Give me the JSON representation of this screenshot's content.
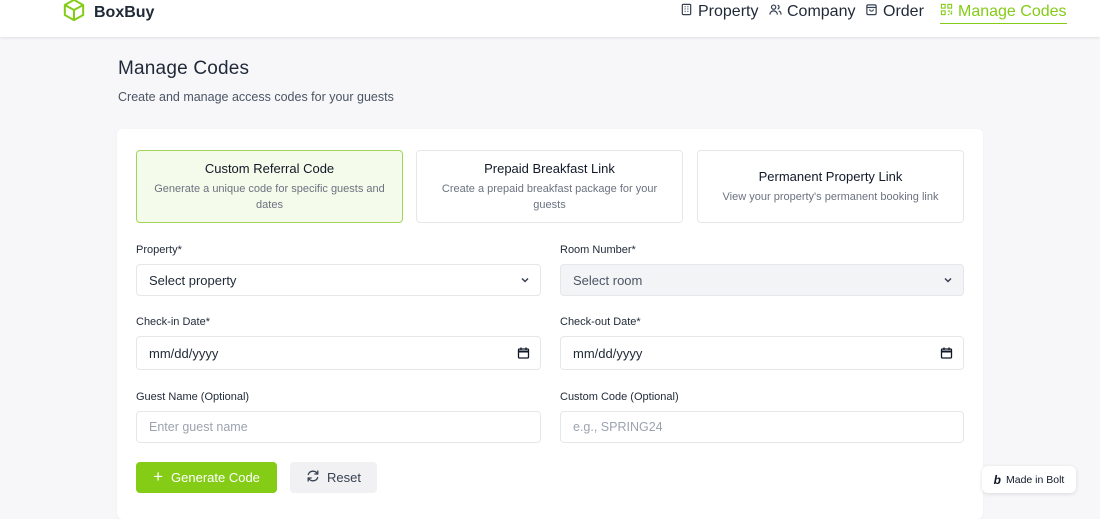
{
  "app": {
    "name": "BoxBuy",
    "brand_color": "#84cc16"
  },
  "nav": {
    "items": [
      {
        "label": "Property",
        "icon": "building-icon"
      },
      {
        "label": "Company",
        "icon": "users-icon"
      },
      {
        "label": "Order",
        "icon": "shopping-bag-icon"
      },
      {
        "label": "Manage Codes",
        "icon": "qr-code-icon",
        "active": true
      }
    ]
  },
  "page": {
    "title": "Manage Codes",
    "subtitle": "Create and manage access codes for your guests"
  },
  "code_types": [
    {
      "title": "Custom Referral Code",
      "description": "Generate a unique code for specific guests and dates",
      "selected": true
    },
    {
      "title": "Prepaid Breakfast Link",
      "description": "Create a prepaid breakfast package for your guests",
      "selected": false
    },
    {
      "title": "Permanent Property Link",
      "description": "View your property's permanent booking link",
      "selected": false
    }
  ],
  "form": {
    "property": {
      "label": "Property*",
      "value": "Select property"
    },
    "room": {
      "label": "Room Number*",
      "value": "Select room"
    },
    "checkin": {
      "label": "Check-in Date*",
      "value": "mm/dd/yyyy"
    },
    "checkout": {
      "label": "Check-out Date*",
      "value": "mm/dd/yyyy"
    },
    "guest_name": {
      "label": "Guest Name (Optional)",
      "placeholder": "Enter guest name"
    },
    "custom_code": {
      "label": "Custom Code (Optional)",
      "placeholder": "e.g., SPRING24"
    }
  },
  "actions": {
    "generate": "Generate Code",
    "reset": "Reset"
  },
  "badge": {
    "label": "Made in Bolt"
  }
}
